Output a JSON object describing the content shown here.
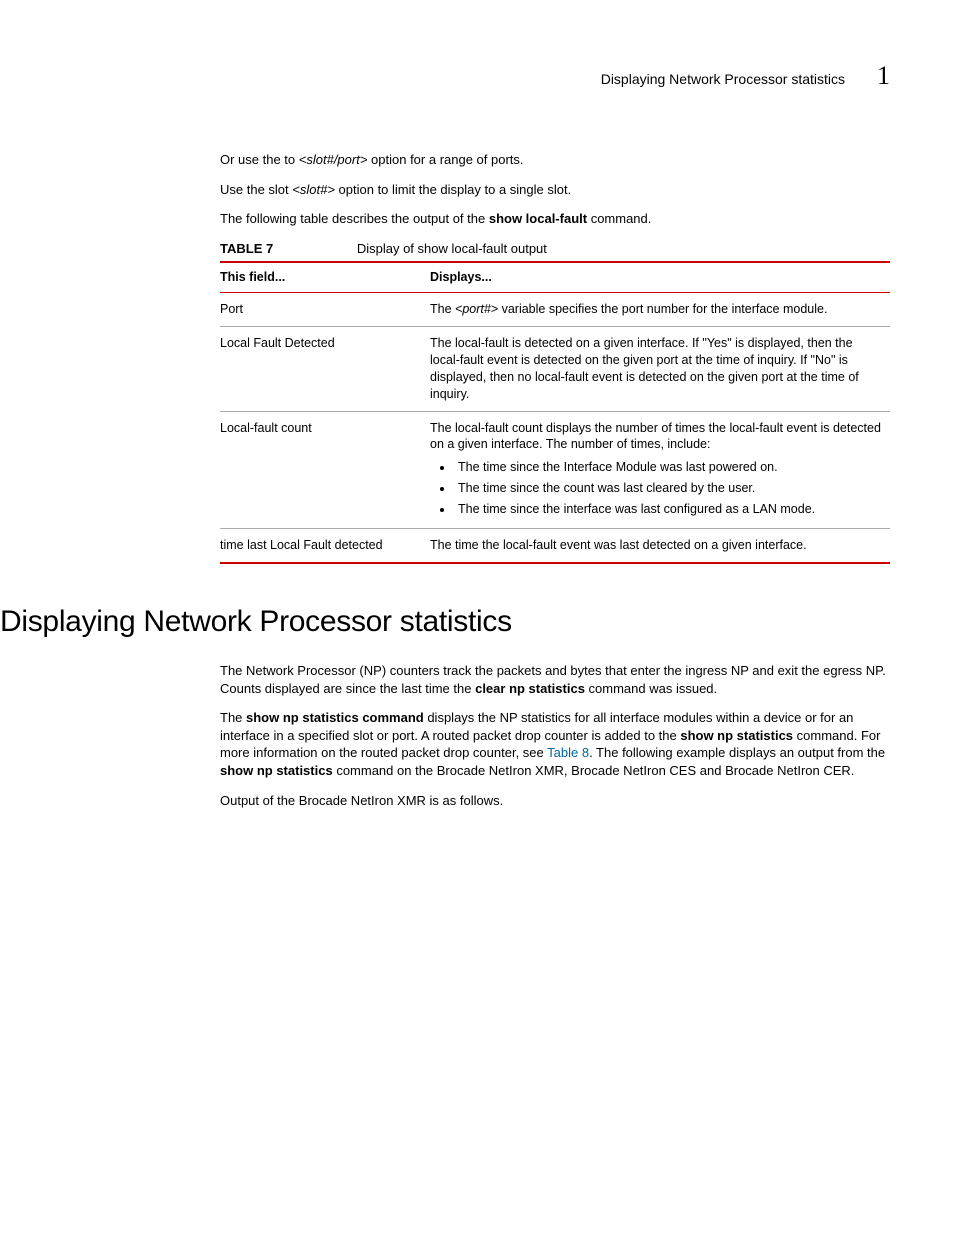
{
  "header": {
    "running_title": "Displaying Network Processor statistics",
    "chapter_number": "1"
  },
  "intro": {
    "p1_a": "Or use the to ",
    "p1_em": "<slot#/port>",
    "p1_b": " option for a range of ports.",
    "p2_a": "Use the slot ",
    "p2_em": "<slot#>",
    "p2_b": " option to limit the display to a single slot.",
    "p3_a": "The following table describes the output of the ",
    "p3_bold": "show local-fault",
    "p3_b": " command."
  },
  "table": {
    "label": "TABLE 7",
    "caption": "Display of show local-fault output",
    "headers": {
      "c1": "This field...",
      "c2": "Displays..."
    },
    "rows": [
      {
        "field": "Port",
        "d_a": "The ",
        "d_em": "<port#>",
        "d_b": " variable specifies the port number for the interface module."
      },
      {
        "field": "Local Fault Detected",
        "d_text": "The local-fault is detected on a given interface. If \"Yes\" is displayed, then the local-fault event is detected on the given port at the time of inquiry. If \"No\" is displayed, then no local-fault event is detected on the given port at the time of inquiry."
      },
      {
        "field": "Local-fault count",
        "d_text": "The local-fault count displays the number of times the local-fault event is detected on a given interface. The number of times, include:",
        "bullets": [
          "The time since the Interface Module was last powered on.",
          "The time since the count was last cleared by the user.",
          "The time since the interface was last configured as a LAN mode."
        ]
      },
      {
        "field": "time last Local Fault detected",
        "d_text": "The time the local-fault event was last detected on a given interface."
      }
    ]
  },
  "section": {
    "heading": "Displaying Network Processor statistics",
    "p1_a": "The Network Processor (NP) counters track the packets and bytes that enter the ingress NP and exit the egress NP. Counts displayed are since the last time the ",
    "p1_bold": "clear np statistics",
    "p1_b": " command was issued.",
    "p2_a": "The ",
    "p2_bold1": "show np statistics command",
    "p2_b": " displays the NP statistics for all interface modules within a device or for an interface in a specified slot or port. A routed packet drop counter is added to the ",
    "p2_bold2": "show np statistics",
    "p2_c": " command. For more information on the routed packet drop counter, see ",
    "p2_link": "Table 8",
    "p2_d": ". The following example displays an output from the ",
    "p2_bold3": "show np statistics",
    "p2_e": " command on the Brocade NetIron XMR, Brocade NetIron CES and Brocade NetIron CER.",
    "p3": "Output of the Brocade NetIron XMR is as follows."
  }
}
